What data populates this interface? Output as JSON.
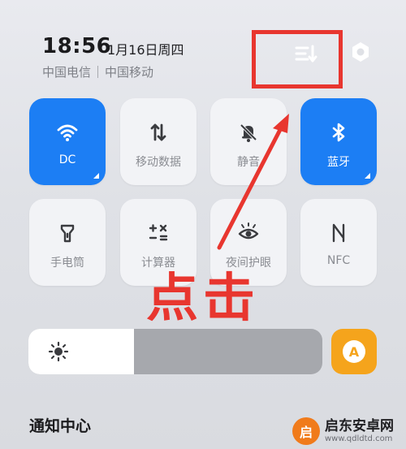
{
  "status": {
    "time": "18:56",
    "date": "1月16日周四",
    "carrier_1": "中国电信",
    "carrier_2": "中国移动"
  },
  "header_icons": {
    "edit": "edit-order-icon",
    "settings": "settings-gear-icon"
  },
  "tiles": [
    {
      "label": "DC",
      "icon": "wifi-icon",
      "active": true
    },
    {
      "label": "移动数据",
      "icon": "mobile-data-icon",
      "active": false
    },
    {
      "label": "静音",
      "icon": "mute-bell-icon",
      "active": false
    },
    {
      "label": "蓝牙",
      "icon": "bluetooth-icon",
      "active": true
    },
    {
      "label": "手电筒",
      "icon": "flashlight-icon",
      "active": false
    },
    {
      "label": "计算器",
      "icon": "calculator-icon",
      "active": false
    },
    {
      "label": "夜间护眼",
      "icon": "eye-icon",
      "active": false
    },
    {
      "label": "NFC",
      "icon": "nfc-icon",
      "active": false
    }
  ],
  "brightness": {
    "level_percent": 36,
    "icon": "sun-icon",
    "auto_label": "A"
  },
  "notification_center": {
    "title": "通知中心"
  },
  "annotation": {
    "text": "点击",
    "color": "#e8362f"
  },
  "watermark": {
    "logo_text": "启",
    "name": "启东安卓网",
    "url": "www.qdldtd.com"
  },
  "colors": {
    "accent_blue": "#1c7ef4",
    "auto_orange": "#f5a41c"
  }
}
